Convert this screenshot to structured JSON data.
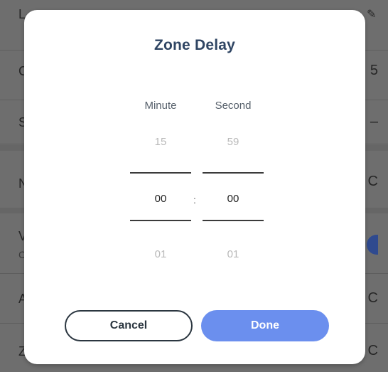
{
  "background": {
    "row_letters": [
      "L",
      "C",
      "S",
      "N",
      "V",
      "A",
      "Z"
    ],
    "row_sub_letter": "C",
    "right_values": [
      "5",
      "–",
      "C",
      "C",
      "C"
    ],
    "accent_toggle_color": "#2f4a8f"
  },
  "dialog": {
    "title": "Zone Delay",
    "columns": {
      "minute_label": "Minute",
      "second_label": "Second"
    },
    "minute": {
      "above": "15",
      "selected": "00",
      "below": "01"
    },
    "second": {
      "above": "59",
      "selected": "00",
      "below": "01"
    },
    "separator": ":",
    "cancel_label": "Cancel",
    "done_label": "Done",
    "done_color": "#6b8fee"
  }
}
